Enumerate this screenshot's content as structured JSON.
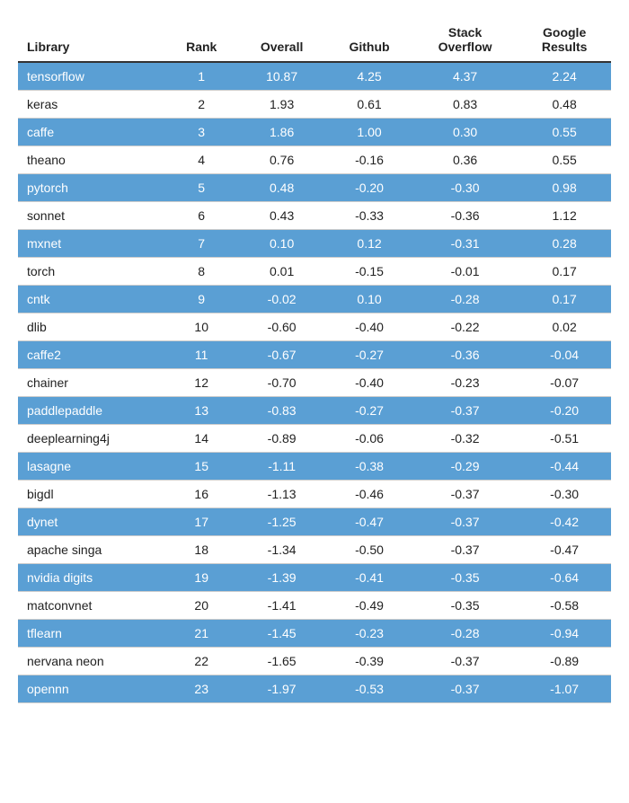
{
  "table": {
    "headers": {
      "library": "Library",
      "rank": "Rank",
      "overall": "Overall",
      "github": "Github",
      "stackoverflow": "Stack\nOverflow",
      "google": "Google\nResults"
    },
    "rows": [
      {
        "library": "tensorflow",
        "rank": 1,
        "overall": "10.87",
        "github": "4.25",
        "stackoverflow": "4.37",
        "google": "2.24"
      },
      {
        "library": "keras",
        "rank": 2,
        "overall": "1.93",
        "github": "0.61",
        "stackoverflow": "0.83",
        "google": "0.48"
      },
      {
        "library": "caffe",
        "rank": 3,
        "overall": "1.86",
        "github": "1.00",
        "stackoverflow": "0.30",
        "google": "0.55"
      },
      {
        "library": "theano",
        "rank": 4,
        "overall": "0.76",
        "github": "-0.16",
        "stackoverflow": "0.36",
        "google": "0.55"
      },
      {
        "library": "pytorch",
        "rank": 5,
        "overall": "0.48",
        "github": "-0.20",
        "stackoverflow": "-0.30",
        "google": "0.98"
      },
      {
        "library": "sonnet",
        "rank": 6,
        "overall": "0.43",
        "github": "-0.33",
        "stackoverflow": "-0.36",
        "google": "1.12"
      },
      {
        "library": "mxnet",
        "rank": 7,
        "overall": "0.10",
        "github": "0.12",
        "stackoverflow": "-0.31",
        "google": "0.28"
      },
      {
        "library": "torch",
        "rank": 8,
        "overall": "0.01",
        "github": "-0.15",
        "stackoverflow": "-0.01",
        "google": "0.17"
      },
      {
        "library": "cntk",
        "rank": 9,
        "overall": "-0.02",
        "github": "0.10",
        "stackoverflow": "-0.28",
        "google": "0.17"
      },
      {
        "library": "dlib",
        "rank": 10,
        "overall": "-0.60",
        "github": "-0.40",
        "stackoverflow": "-0.22",
        "google": "0.02"
      },
      {
        "library": "caffe2",
        "rank": 11,
        "overall": "-0.67",
        "github": "-0.27",
        "stackoverflow": "-0.36",
        "google": "-0.04"
      },
      {
        "library": "chainer",
        "rank": 12,
        "overall": "-0.70",
        "github": "-0.40",
        "stackoverflow": "-0.23",
        "google": "-0.07"
      },
      {
        "library": "paddlepaddle",
        "rank": 13,
        "overall": "-0.83",
        "github": "-0.27",
        "stackoverflow": "-0.37",
        "google": "-0.20"
      },
      {
        "library": "deeplearning4j",
        "rank": 14,
        "overall": "-0.89",
        "github": "-0.06",
        "stackoverflow": "-0.32",
        "google": "-0.51"
      },
      {
        "library": "lasagne",
        "rank": 15,
        "overall": "-1.11",
        "github": "-0.38",
        "stackoverflow": "-0.29",
        "google": "-0.44"
      },
      {
        "library": "bigdl",
        "rank": 16,
        "overall": "-1.13",
        "github": "-0.46",
        "stackoverflow": "-0.37",
        "google": "-0.30"
      },
      {
        "library": "dynet",
        "rank": 17,
        "overall": "-1.25",
        "github": "-0.47",
        "stackoverflow": "-0.37",
        "google": "-0.42"
      },
      {
        "library": "apache singa",
        "rank": 18,
        "overall": "-1.34",
        "github": "-0.50",
        "stackoverflow": "-0.37",
        "google": "-0.47"
      },
      {
        "library": "nvidia digits",
        "rank": 19,
        "overall": "-1.39",
        "github": "-0.41",
        "stackoverflow": "-0.35",
        "google": "-0.64"
      },
      {
        "library": "matconvnet",
        "rank": 20,
        "overall": "-1.41",
        "github": "-0.49",
        "stackoverflow": "-0.35",
        "google": "-0.58"
      },
      {
        "library": "tflearn",
        "rank": 21,
        "overall": "-1.45",
        "github": "-0.23",
        "stackoverflow": "-0.28",
        "google": "-0.94"
      },
      {
        "library": "nervana neon",
        "rank": 22,
        "overall": "-1.65",
        "github": "-0.39",
        "stackoverflow": "-0.37",
        "google": "-0.89"
      },
      {
        "library": "opennn",
        "rank": 23,
        "overall": "-1.97",
        "github": "-0.53",
        "stackoverflow": "-0.37",
        "google": "-1.07"
      }
    ]
  }
}
